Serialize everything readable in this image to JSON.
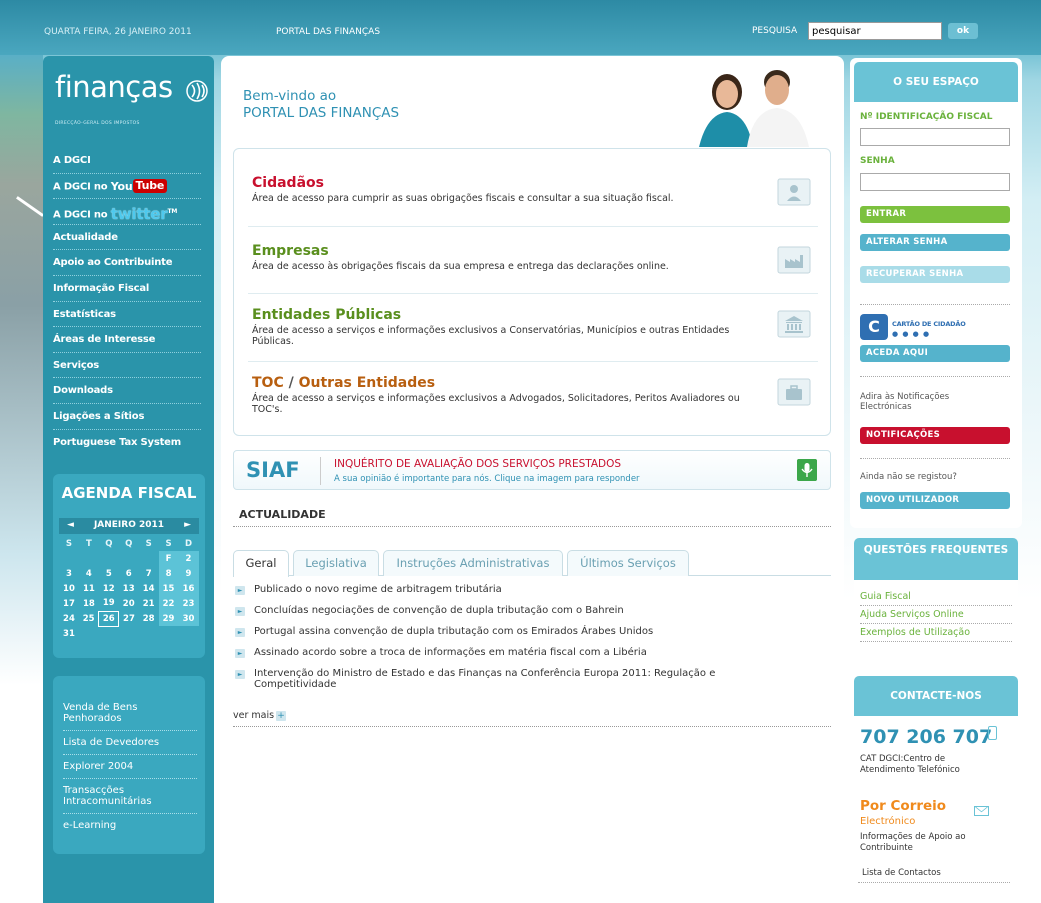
{
  "header": {
    "date": "QUARTA FEIRA, 26 JANEIRO 2011",
    "portal": "PORTAL DAS FINANÇAS",
    "search_label": "PESQUISA",
    "search_value": "pesquisar",
    "ok": "ok"
  },
  "logo": {
    "text": "finanças",
    "sub": "DIRECÇÃO-GERAL DOS IMPOSTOS"
  },
  "nav": {
    "dgci": "A DGCI",
    "youtube_prefix": "A DGCI no",
    "youtube_you": "You",
    "youtube_tube": "Tube",
    "twitter_prefix": "A DGCI no",
    "twitter_word": "twitter",
    "twitter_tm": "TM",
    "items": [
      "Actualidade",
      "Apoio ao Contribuinte",
      "Informação Fiscal",
      "Estatísticas",
      "Áreas de Interesse",
      "Serviços",
      "Downloads",
      "Ligações a Sítios",
      "Portuguese Tax System"
    ]
  },
  "agenda": {
    "title": "AGENDA FISCAL",
    "month": "JANEIRO 2011",
    "prev": "◄",
    "next": "►",
    "days": [
      "S",
      "T",
      "Q",
      "Q",
      "S",
      "S",
      "D"
    ],
    "weeks": [
      [
        "",
        "",
        "",
        "",
        "",
        "F",
        "2"
      ],
      [
        "3",
        "4",
        "5",
        "6",
        "7",
        "8",
        "9"
      ],
      [
        "10",
        "11",
        "12",
        "13",
        "14",
        "15",
        "16"
      ],
      [
        "17",
        "18",
        "19",
        "20",
        "21",
        "22",
        "23"
      ],
      [
        "24",
        "25",
        "26",
        "27",
        "28",
        "29",
        "30"
      ],
      [
        "31",
        "",
        "",
        "",
        "",
        "",
        ""
      ]
    ]
  },
  "links2": [
    "Venda de Bens Penhorados",
    "Lista de Devedores",
    "Explorer 2004",
    "Transacções Intracomunitárias",
    "e-Learning"
  ],
  "welcome": {
    "line1": "Bem-vindo ao",
    "line2": "PORTAL DAS FINANÇAS"
  },
  "sections": [
    {
      "title": "Cidadãos",
      "desc": "Área de acesso para cumprir as suas obrigações fiscais e consultar a sua situação fiscal.",
      "color": "#c8102e"
    },
    {
      "title": "Empresas",
      "desc": "Área de acesso às obrigações fiscais da sua empresa e entrega das declarações online.",
      "color": "#5a8f1e"
    },
    {
      "title": "Entidades Públicas",
      "desc": "Área de acesso a serviços e informações exclusivos a Conservatórias, Municípios e outras Entidades Públicas.",
      "color": "#5a8f1e"
    },
    {
      "title_a": "TOC",
      "title_sep": " / ",
      "title_b": "Outras Entidades",
      "desc": "Área de acesso a serviços e informações exclusivos a Advogados, Solicitadores, Peritos Avaliadores ou TOC's.",
      "color": "#b85f10"
    }
  ],
  "siaf": {
    "logo": "SIAF",
    "title": "INQUÉRITO DE AVALIAÇÃO DOS SERVIÇOS PRESTADOS",
    "sub": "A sua opinião é importante para nós. Clique na imagem para responder"
  },
  "actualidade": {
    "title": "ACTUALIDADE",
    "tabs": [
      "Geral",
      "Legislativa",
      "Instruções Administrativas",
      "Últimos Serviços"
    ],
    "news": [
      "Publicado o novo regime de arbitragem tributária",
      "Concluídas negociações de convenção de dupla tributação com o Bahrein",
      "Portugal assina convenção de dupla tributação com os Emirados Árabes Unidos",
      "Assinado acordo sobre a troca de informações em matéria fiscal com a Libéria",
      "Intervenção do Ministro de Estado e das Finanças na Conferência Europa 2011: Regulação e Competitividade"
    ],
    "more": "ver mais",
    "more_icon": "+"
  },
  "espaco": {
    "title": "O SEU ESPAÇO",
    "nif_label": "Nº IDENTIFICAÇÃO FISCAL",
    "senha_label": "SENHA",
    "entrar": "ENTRAR",
    "alterar": "ALTERAR SENHA",
    "recuperar": "RECUPERAR SENHA",
    "cartao_text": "CARTÃO DE CIDADÃO",
    "cartao_dots": "● ● ● ●",
    "cartao_letter": "C",
    "aceda": "ACEDA AQUI",
    "adira": "Adira às Notificações Electrónicas",
    "notificacoes": "NOTIFICAÇÕES",
    "ainda": "Ainda não se registou?",
    "novo": "NOVO UTILIZADOR"
  },
  "faq": {
    "title": "QUESTÕES FREQUENTES",
    "links": [
      "Guia Fiscal",
      "Ajuda Serviços Online",
      "Exemplos de Utilização"
    ]
  },
  "contacte": {
    "title": "CONTACTE-NOS",
    "phone": "707 206 707",
    "cat": "CAT DGCI:Centro de Atendimento Telefónico",
    "correio": "Por Correio",
    "electronico": "Electrónico",
    "correio_desc": "Informações de Apoio ao Contribuinte",
    "lista": "Lista de Contactos"
  },
  "colors": {
    "accent": "#2f91b3",
    "green": "#6ab23c",
    "red": "#c8102e",
    "brand_teal": "#2a94aa"
  }
}
